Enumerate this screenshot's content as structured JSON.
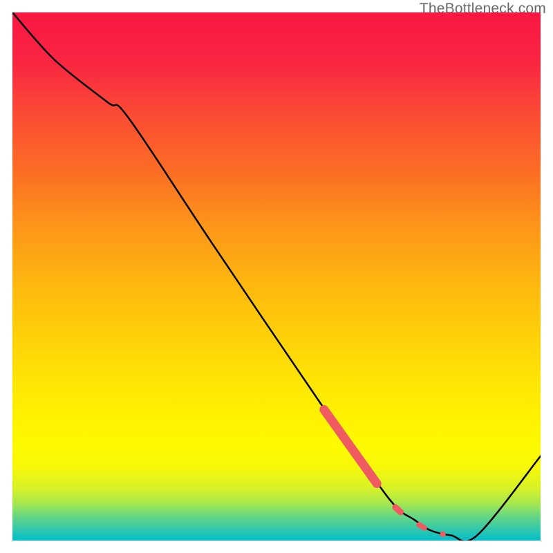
{
  "watermark": "TheBottleneck.com",
  "chart_data": {
    "type": "line",
    "title": "",
    "xlabel": "",
    "ylabel": "",
    "xlim": [
      0,
      100
    ],
    "ylim": [
      0,
      100
    ],
    "grid": false,
    "legend": false,
    "description": "A single black curve over a vertical red-to-green gradient. The y axis corresponds to bottleneck percentage (red high at top, green low at bottom). The curve descends from top-left to a minimum near x≈83 then rises again toward the right. A cluster of salmon-colored dots highlights points along the descending segment between roughly x=59 and x=82.",
    "series": [
      {
        "name": "bottleneck-curve",
        "color": "#000000",
        "x": [
          0,
          8,
          18,
          22,
          38,
          59,
          69,
          73,
          76,
          79,
          83,
          88,
          100
        ],
        "values": [
          100,
          91,
          83,
          80,
          56,
          25,
          11,
          6,
          4,
          2,
          1,
          1,
          16
        ]
      }
    ],
    "dots": {
      "name": "highlight-dots",
      "color": "#ef5b61",
      "points": [
        {
          "x": 59.0,
          "y": 24.8
        },
        {
          "x": 60.0,
          "y": 23.4
        },
        {
          "x": 61.0,
          "y": 22.0
        },
        {
          "x": 62.0,
          "y": 20.6
        },
        {
          "x": 63.0,
          "y": 19.2
        },
        {
          "x": 64.0,
          "y": 17.8
        },
        {
          "x": 65.0,
          "y": 16.4
        },
        {
          "x": 66.0,
          "y": 15.0
        },
        {
          "x": 67.0,
          "y": 13.6
        },
        {
          "x": 68.0,
          "y": 12.2
        },
        {
          "x": 69.0,
          "y": 10.8
        },
        {
          "x": 72.5,
          "y": 6.3
        },
        {
          "x": 73.5,
          "y": 5.4
        },
        {
          "x": 77.0,
          "y": 3.0
        },
        {
          "x": 78.0,
          "y": 2.4
        },
        {
          "x": 81.5,
          "y": 1.2
        }
      ]
    }
  }
}
